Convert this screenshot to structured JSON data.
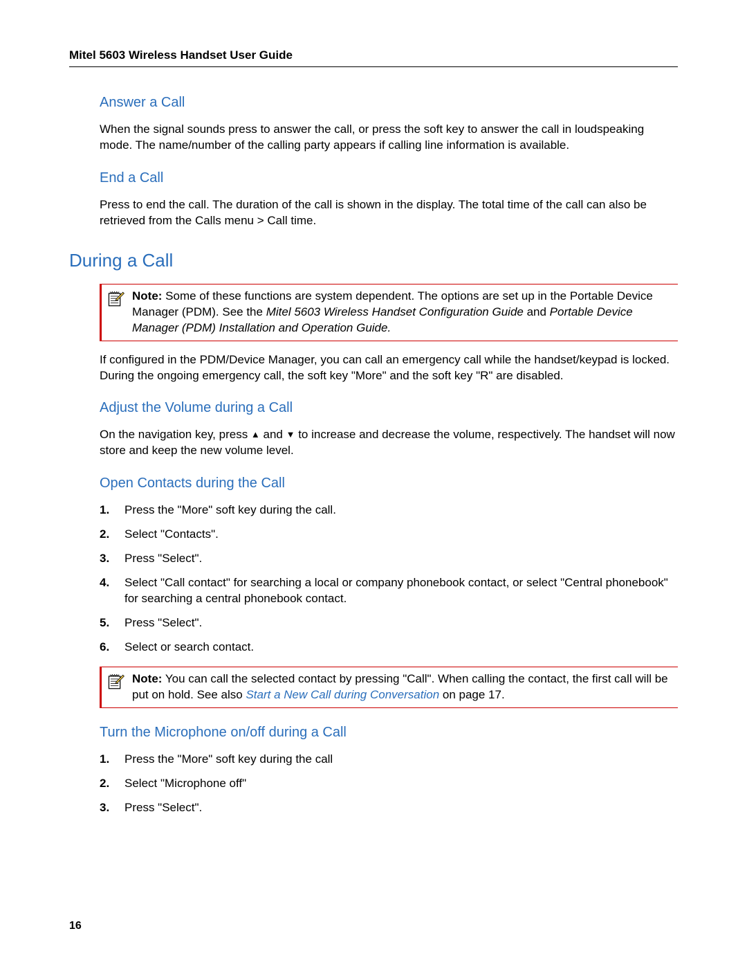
{
  "header": {
    "title": "Mitel 5603 Wireless Handset User Guide"
  },
  "page_number": "16",
  "sections": {
    "answer": {
      "heading": "Answer a Call",
      "body": "When the signal sounds press         to answer the call, or press the         soft key to answer the call in loudspeaking mode. The name/number of the calling party appears if calling line information is available."
    },
    "end": {
      "heading": "End a Call",
      "body": "Press         to end the call. The duration of the call is shown in the display. The total time of the call can also be retrieved from the Calls menu > Call time."
    },
    "during": {
      "heading": "During a Call",
      "note_bold": "Note:",
      "note_text1": " Some of these functions are system dependent. The options are set up in the Portable Device Manager (PDM). See the ",
      "note_italic1": "Mitel 5603 Wireless Handset Configuration Guide",
      "note_text2": " and ",
      "note_italic2": "Portable Device Manager (PDM) Installation and Operation Guide.",
      "body": "If configured in the PDM/Device Manager, you can call an emergency call while the handset/keypad is locked. During the ongoing emergency call, the soft key \"More\" and the soft key \"R\" are disabled."
    },
    "volume": {
      "heading": "Adjust the Volume during a Call",
      "body_pre": "On the navigation key, press ",
      "body_mid": " and ",
      "body_post": " to increase and decrease the volume, respectively. The handset will now store and keep the new volume level."
    },
    "contacts": {
      "heading": "Open Contacts during the Call",
      "steps": [
        "Press the \"More\" soft key during the call.",
        "Select \"Contacts\".",
        "Press \"Select\".",
        "Select \"Call contact\" for searching a local or company phonebook contact, or select \"Central phonebook\" for searching a central phonebook contact.",
        "Press \"Select\".",
        "Select or search contact."
      ],
      "note_bold": "Note:",
      "note_text1": " You can call the selected contact by pressing \"Call\". When calling the contact, the first call will be put on hold. See also ",
      "note_link": "Start a New Call during Conversation",
      "note_text2": " on page 17."
    },
    "mic": {
      "heading": "Turn the Microphone on/off during a Call",
      "steps": [
        "Press the \"More\" soft key during the call",
        "Select \"Microphone off\"",
        "Press \"Select\"."
      ]
    }
  }
}
